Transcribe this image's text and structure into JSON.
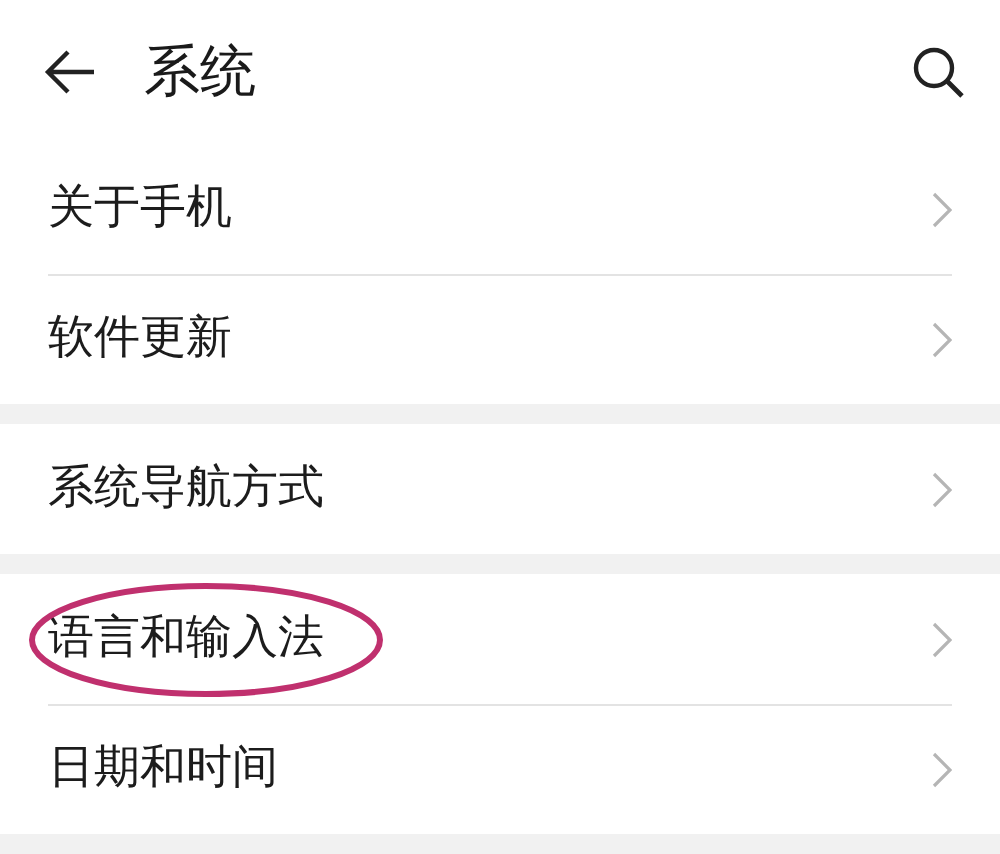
{
  "header": {
    "title": "系统"
  },
  "groups": [
    {
      "items": [
        {
          "label": "关于手机",
          "highlighted": false
        },
        {
          "label": "软件更新",
          "highlighted": false
        }
      ]
    },
    {
      "items": [
        {
          "label": "系统导航方式",
          "highlighted": false
        }
      ]
    },
    {
      "items": [
        {
          "label": "语言和输入法",
          "highlighted": true
        },
        {
          "label": "日期和时间",
          "highlighted": false
        }
      ]
    }
  ]
}
